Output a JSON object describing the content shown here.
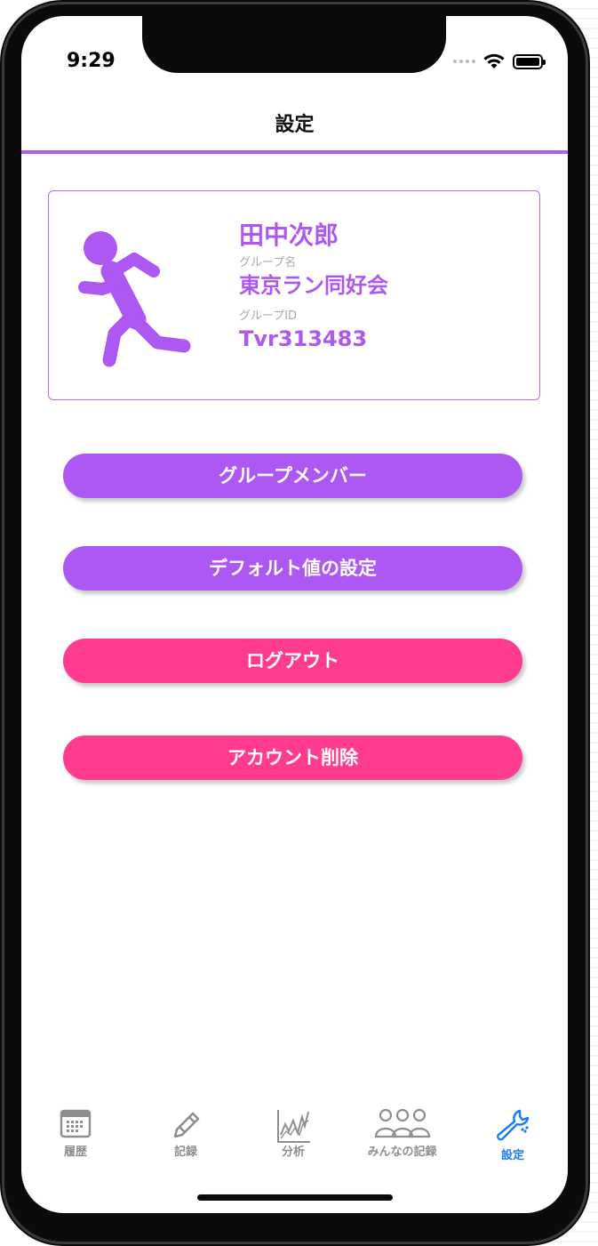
{
  "status_bar": {
    "time": "9:29"
  },
  "nav": {
    "title": "設定"
  },
  "profile": {
    "name": "田中次郎",
    "group_name_label": "グループ名",
    "group_name": "東京ラン同好会",
    "group_id_label": "グループID",
    "group_id": "Tvr313483"
  },
  "buttons": {
    "group_members": "グループメンバー",
    "default_settings": "デフォルト値の設定",
    "logout": "ログアウト",
    "delete_account": "アカウント削除"
  },
  "tabs": [
    {
      "label": "履歴",
      "icon": "calendar-icon"
    },
    {
      "label": "記録",
      "icon": "pencil-icon"
    },
    {
      "label": "分析",
      "icon": "line-chart-icon"
    },
    {
      "label": "みんなの記録",
      "icon": "people-icon"
    },
    {
      "label": "設定",
      "icon": "wrench-icon",
      "active": true
    }
  ],
  "colors": {
    "accent_purple": "#ad58f2",
    "accent_pink": "#ff3c8f",
    "active_tab": "#1b7ef0",
    "inactive_tab": "#8e8e8e"
  }
}
